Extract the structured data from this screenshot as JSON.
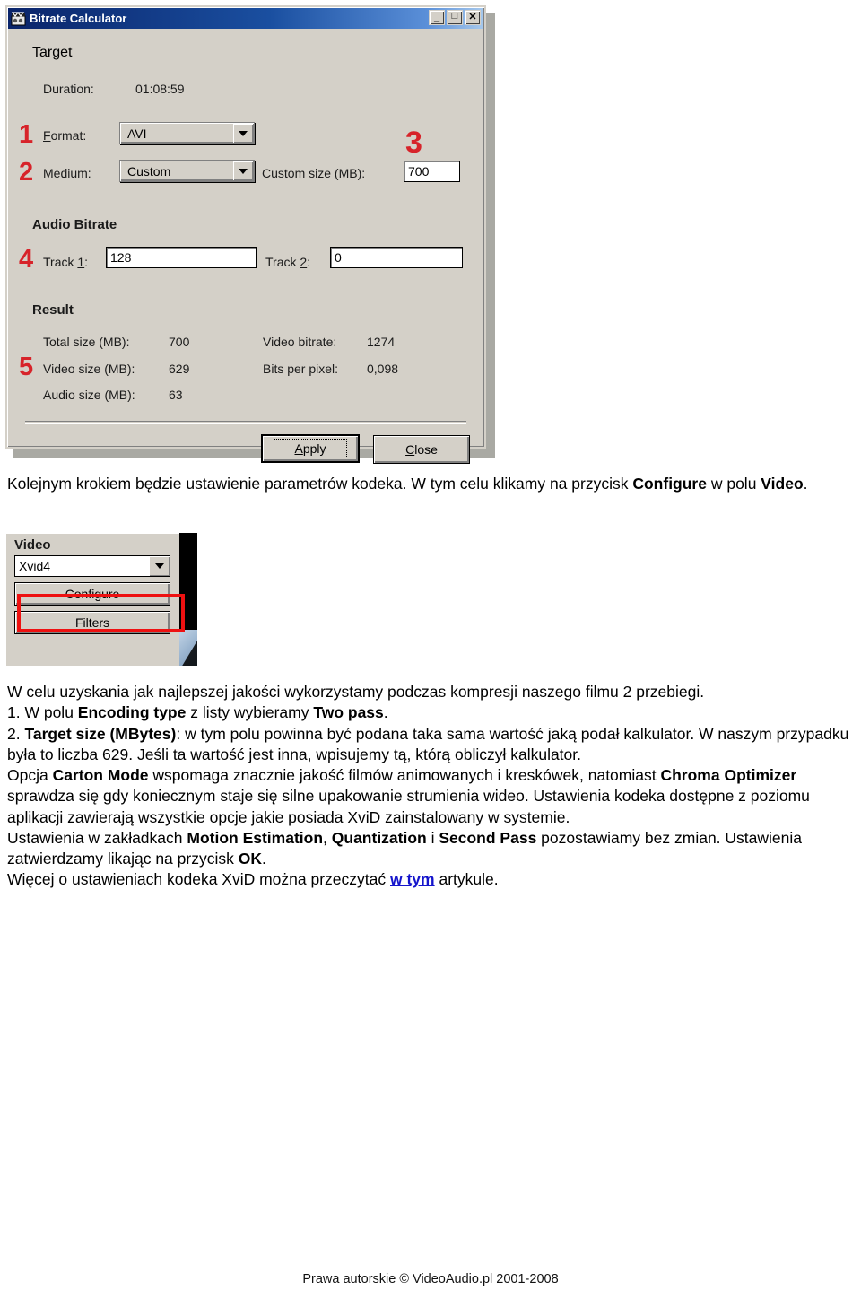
{
  "dialog": {
    "title": "Bitrate Calculator",
    "icon": "film-clapper-icon",
    "window_buttons": {
      "minimize": "_",
      "maximize": "□",
      "close": "✕"
    },
    "groups": {
      "target": {
        "title": "Target",
        "duration_label": "Duration:",
        "duration_value": "01:08:59",
        "format_label": "Format:",
        "format_value": "AVI",
        "medium_label": "Medium:",
        "medium_value": "Custom",
        "custom_size_label": "Custom size (MB):",
        "custom_size_value": "700"
      },
      "audio": {
        "title": "Audio Bitrate",
        "track1_label": "Track 1:",
        "track1_value": "128",
        "track2_label": "Track 2:",
        "track2_value": "0"
      },
      "result": {
        "title": "Result",
        "total_size_label": "Total size (MB):",
        "total_size_value": "700",
        "video_size_label": "Video size (MB):",
        "video_size_value": "629",
        "audio_size_label": "Audio size (MB):",
        "audio_size_value": "63",
        "video_bitrate_label": "Video bitrate:",
        "video_bitrate_value": "1274",
        "bits_per_pixel_label": "Bits per pixel:",
        "bits_per_pixel_value": "0,098"
      }
    },
    "buttons": {
      "apply": "Apply",
      "close": "Close"
    },
    "callouts": {
      "one": "1",
      "two": "2",
      "three": "3",
      "four": "4",
      "five": "5"
    },
    "callout_color": "#d7232a"
  },
  "video_panel": {
    "title": "Video",
    "codec_value": "Xvid4",
    "configure_button": "Configure",
    "filters_button": "Filters",
    "highlight_color": "#ee1111"
  },
  "prose": {
    "para1_part1": "Kolejnym krokiem będzie ustawienie parametrów kodeka. W tym celu klikamy na przycisk ",
    "para1_bold1": "Configure",
    "para1_part2": " w polu ",
    "para1_bold2": "Video",
    "para1_part3": ".",
    "l1": "W celu uzyskania jak najlepszej jakości wykorzystamy podczas kompresji naszego filmu 2 przebiegi.",
    "l2_a": "1. W polu ",
    "l2_b1": "Encoding type",
    "l2_c": " z listy wybieramy ",
    "l2_b2": "Two pass",
    "l2_d": ".",
    "l3_a": "2. ",
    "l3_b1": "Target size (MBytes)",
    "l3_c": ": w tym polu powinna być podana taka sama wartość jaką podał kalkulator. W naszym przypadku była to liczba 629. Jeśli ta wartość jest inna, wpisujemy tą, którą obliczył kalkulator.",
    "l4_a": "Opcja ",
    "l4_b1": "Carton Mode",
    "l4_c": " wspomaga znacznie jakość filmów animowanych i kreskówek, natomiast ",
    "l4_b2": "Chroma Optimizer",
    "l4_d": " sprawdza się gdy koniecznym staje się silne upakowanie strumienia wideo. Ustawienia kodeka dostępne z poziomu aplikacji zawierają wszystkie opcje jakie posiada XviD zainstalowany w systemie.",
    "l5_a": "Ustawienia w zakładkach ",
    "l5_b1": "Motion Estimation",
    "l5_c": ", ",
    "l5_b2": "Quantization",
    "l5_d": " i ",
    "l5_b3": "Second Pass",
    "l5_e": " pozostawiamy bez zmian. Ustawienia zatwierdzamy likając na przycisk ",
    "l5_b4": "OK",
    "l5_f": ".",
    "l6_a": "Więcej o ustawieniach kodeka XviD można przeczytać ",
    "l6_link": "w tym",
    "l6_b": " artykule."
  },
  "footer": {
    "copyright": "Prawa autorskie © VideoAudio.pl 2001-2008"
  }
}
